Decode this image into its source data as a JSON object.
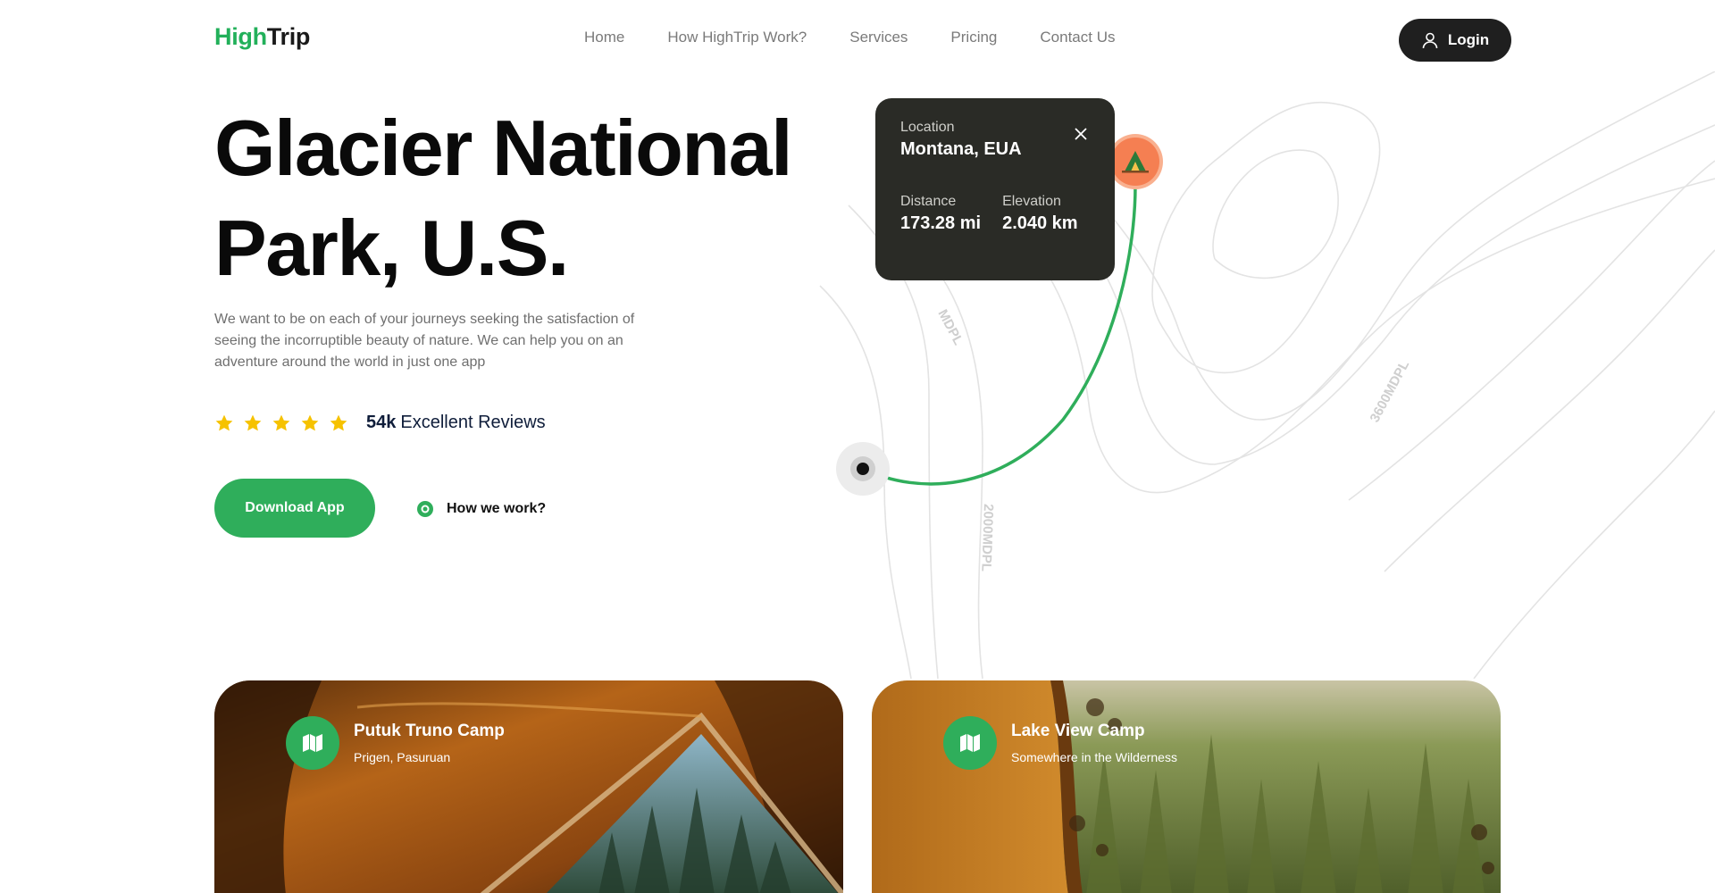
{
  "header": {
    "logo_high": "High",
    "logo_trip": "Trip",
    "nav": [
      "Home",
      "How HighTrip Work?",
      "Services",
      "Pricing",
      "Contact Us"
    ],
    "login_label": "Login"
  },
  "hero": {
    "title_line1": "Glacier National",
    "title_line2": "Park, U.S.",
    "description": "We want to be on each of your journeys seeking the satisfaction of seeing the incorruptible beauty of nature. We can help you on an adventure around the world in just one app",
    "rating_stars": 5,
    "reviews_count": "54k",
    "reviews_label": "Excellent Reviews",
    "download_label": "Download App",
    "how_label": "How we work?"
  },
  "map": {
    "contour_labels": [
      "MDPL",
      "3600MDPL",
      "2000MDPL"
    ],
    "route_color": "#2fae5b",
    "pin_color": "#f57f52",
    "info": {
      "location_label": "Location",
      "location_value": "Montana, EUA",
      "distance_label": "Distance",
      "distance_value": "173.28 mi",
      "elevation_label": "Elevation",
      "elevation_value": "2.040 km"
    }
  },
  "cards": [
    {
      "title": "Putuk Truno Camp",
      "subtitle": "Prigen, Pasuruan",
      "icon": "map-icon"
    },
    {
      "title": "Lake View Camp",
      "subtitle": "Somewhere in the Wilderness",
      "icon": "map-icon"
    }
  ],
  "colors": {
    "accent": "#2fae5b",
    "dark": "#1f1f1f",
    "star": "#f6c200"
  }
}
